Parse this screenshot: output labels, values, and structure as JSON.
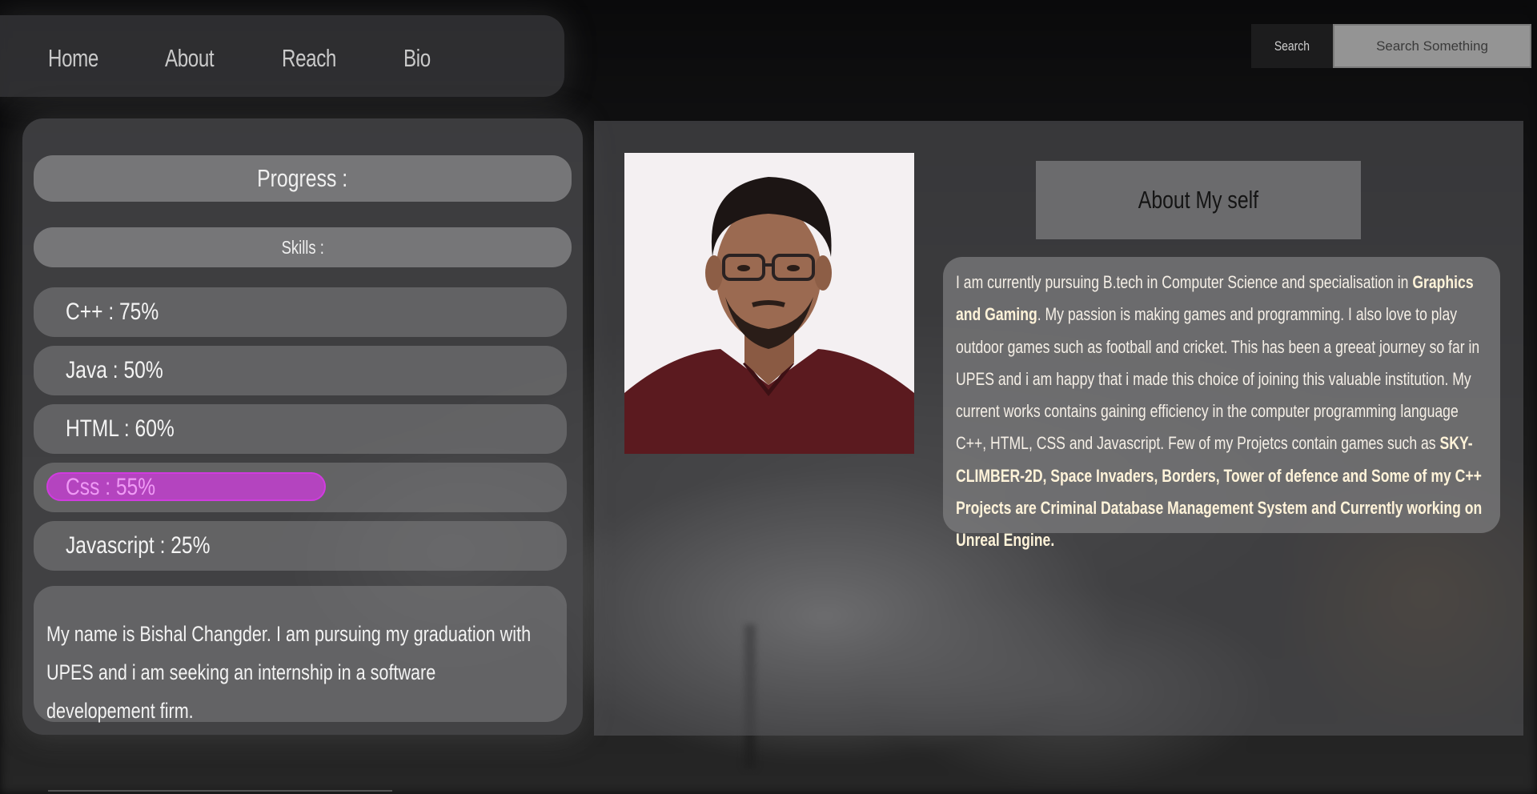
{
  "nav": {
    "items": [
      {
        "label": "Home"
      },
      {
        "label": "About"
      },
      {
        "label": "Reach"
      },
      {
        "label": "Bio"
      }
    ]
  },
  "search": {
    "button_label": "Search",
    "placeholder": "Search Something"
  },
  "progress": {
    "title": "Progress :",
    "skills_title": "Skills :",
    "skills": [
      {
        "label": "C++ : 75%",
        "percent": 75,
        "active": false
      },
      {
        "label": "Java : 50%",
        "percent": 50,
        "active": false
      },
      {
        "label": "HTML : 60%",
        "percent": 60,
        "active": false
      },
      {
        "label": "Css : 55%",
        "percent": 55,
        "active": true
      },
      {
        "label": "Javascript : 25%",
        "percent": 25,
        "active": false
      }
    ],
    "active_color": "#b444bf"
  },
  "intro": {
    "text": "My name is Bishal Changder. I am pursuing my graduation with UPES and i am seeking an internship in a software developement firm."
  },
  "about": {
    "title": "About My self",
    "text_1": "I am currently pursuing B.tech in Computer Science and specialisation in ",
    "bold_1": "Graphics and Gaming",
    "text_2": ". My passion is making games and programming. I also love to play outdoor games such as football and cricket. This has been a greeat journey so far in UPES and i am happy that i made this choice of joining this valuable institution. My current works contains gaining efficiency in the computer programming language C++, HTML, CSS and Javascript. Few of my Projetcs contain games such as ",
    "bold_2": "SKY-CLIMBER-2D, Space Invaders, Borders, Tower of defence and Some of my C++ Projects are Criminal Database Management System and Currently working on Unreal Engine."
  }
}
